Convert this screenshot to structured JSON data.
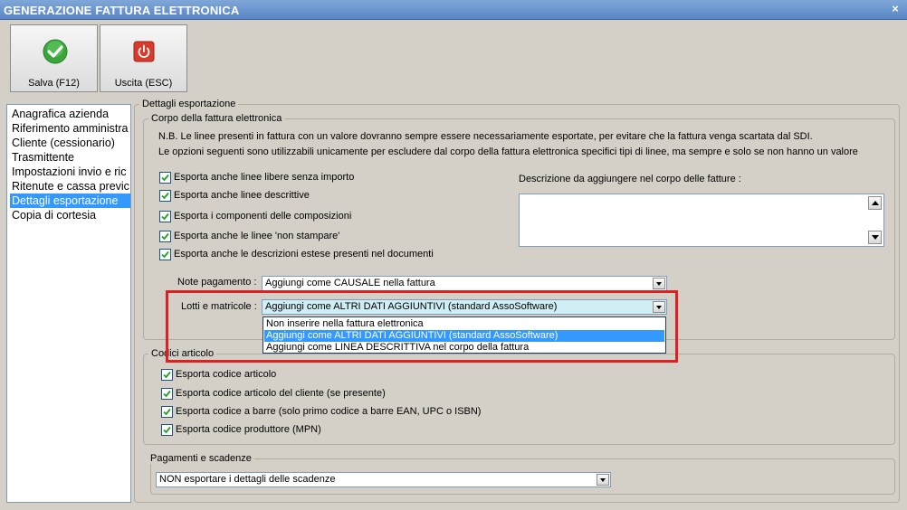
{
  "window": {
    "title": "GENERAZIONE FATTURA ELETTRONICA",
    "close_glyph": "×"
  },
  "toolbar": {
    "save_label": "Salva (F12)",
    "exit_label": "Uscita (ESC)"
  },
  "sidebar": {
    "items": [
      {
        "label": "Anagrafica azienda"
      },
      {
        "label": "Riferimento amministra"
      },
      {
        "label": "Cliente (cessionario)"
      },
      {
        "label": "Trasmittente"
      },
      {
        "label": "Impostazioni invio e ric"
      },
      {
        "label": "Ritenute e cassa previc"
      },
      {
        "label": "Dettagli esportazione"
      },
      {
        "label": "Copia di cortesia"
      }
    ],
    "selected_index": 6
  },
  "main": {
    "section_title": "Dettagli esportazione",
    "corpo": {
      "title": "Corpo della fattura elettronica",
      "note1": "N.B. Le linee presenti in fattura con un valore dovranno sempre essere necessariamente esportate, per evitare che la fattura venga scartata dal SDI.",
      "note2": "Le opzioni seguenti sono utilizzabili unicamente per escludere dal corpo della fattura elettronica specifici tipi di linee, ma sempre e solo se non hanno un valore",
      "checkboxes": [
        {
          "label": "Esporta anche linee libere senza importo",
          "checked": true
        },
        {
          "label": "Esporta anche linee descrittive",
          "checked": true
        },
        {
          "label": "Esporta i componenti delle composizioni",
          "checked": true
        },
        {
          "label": "Esporta anche le linee 'non stampare'",
          "checked": true
        },
        {
          "label": "Esporta anche le descrizioni estese presenti nel documenti",
          "checked": true
        }
      ],
      "descrizione_label": "Descrizione da aggiungere nel corpo delle fatture :",
      "descrizione_value": "",
      "note_pagamento_label": "Note pagamento :",
      "note_pagamento_value": "Aggiungi come CAUSALE nella fattura",
      "lotti_label": "Lotti e matricole :",
      "lotti_value": "Aggiungi come ALTRI DATI AGGIUNTIVI (standard AssoSoftware)",
      "lotti_options": [
        "Non inserire nella fattura elettronica",
        "Aggiungi come ALTRI DATI AGGIUNTIVI (standard AssoSoftware)",
        "Aggiungi come LINEA DESCRITTIVA nel corpo della fattura"
      ],
      "lotti_selected_index": 1
    },
    "codici": {
      "title": "Codici articolo",
      "checkboxes": [
        {
          "label": "Esporta codice articolo",
          "checked": true
        },
        {
          "label": "Esporta codice articolo del cliente (se presente)",
          "checked": true
        },
        {
          "label": "Esporta codice a barre (solo primo codice a barre EAN, UPC o ISBN)",
          "checked": true
        },
        {
          "label": "Esporta codice produttore (MPN)",
          "checked": true
        }
      ]
    },
    "pagamenti": {
      "title": "Pagamenti e scadenze",
      "value": "NON esportare i dettagli delle scadenze"
    }
  },
  "colors": {
    "titlebar": "#5a86c6",
    "selection": "#3399ff",
    "highlight_border": "#e02020",
    "save_icon": "#3aa63a",
    "exit_icon": "#d83b2b"
  },
  "icons": {
    "save": "check-circle-icon",
    "exit": "power-icon"
  }
}
